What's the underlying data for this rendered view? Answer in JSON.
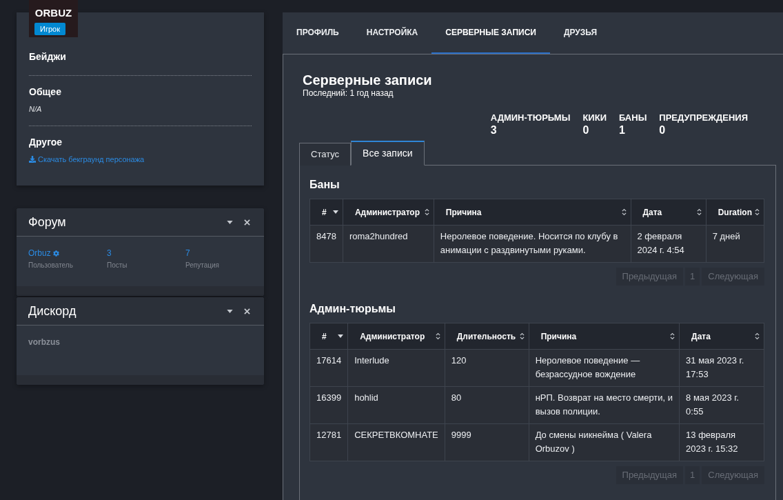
{
  "profile": {
    "name": "ORBUZ",
    "role": "Игрок",
    "sections": [
      {
        "title": "Бейджи"
      },
      {
        "title": "Общее",
        "value": "N/A"
      },
      {
        "title": "Другое",
        "link": "Скачать бекграунд персонажа"
      }
    ]
  },
  "widgets": [
    {
      "title": "Форум",
      "stats": [
        {
          "kind": "user",
          "value": "Orbuz",
          "label": "Пользователь"
        },
        {
          "kind": "count",
          "value": "3",
          "label": "Посты"
        },
        {
          "kind": "count",
          "value": "7",
          "label": "Репутация"
        }
      ]
    },
    {
      "title": "Дискорд",
      "text": "vorbzus"
    }
  ],
  "nav_tabs": [
    {
      "label": "ПРОФИЛЬ",
      "selected": false
    },
    {
      "label": "НАСТРОЙКА",
      "selected": false
    },
    {
      "label": "СЕРВЕРНЫЕ ЗАПИСИ",
      "selected": true
    },
    {
      "label": "ДРУЗЬЯ",
      "selected": false
    }
  ],
  "records": {
    "title": "Серверные записи",
    "subtitle": "Последний: 1 год назад",
    "stats": [
      {
        "label": "АДМИН-ТЮРЬМЫ",
        "value": "3"
      },
      {
        "label": "КИКИ",
        "value": "0"
      },
      {
        "label": "БАНЫ",
        "value": "1"
      },
      {
        "label": "ПРЕДУПРЕЖДЕНИЯ",
        "value": "0"
      }
    ],
    "subtabs": [
      {
        "label": "Статус",
        "selected": false
      },
      {
        "label": "Все записи",
        "selected": true
      }
    ],
    "sections": [
      {
        "title": "Баны",
        "columns": [
          {
            "label": "#",
            "sorted": true
          },
          {
            "label": "Администратор",
            "sorted": false
          },
          {
            "label": "Причина",
            "sorted": false
          },
          {
            "label": "Дата",
            "sorted": false
          },
          {
            "label": "Duration",
            "sorted": false
          }
        ],
        "rows": [
          [
            "8478",
            "roma2hundred",
            "Неролевое поведение. Носится по клубу в анимации с раздвинутыми руками.",
            "2 февраля 2024 г. 4:54",
            "7 дней"
          ]
        ],
        "pagination": [
          {
            "kind": "prev",
            "label": "Предыдущая",
            "disabled": true
          },
          {
            "kind": "page",
            "label": "1",
            "disabled": true
          },
          {
            "kind": "next",
            "label": "Следующая",
            "disabled": true
          }
        ]
      },
      {
        "title": "Админ-тюрьмы",
        "columns": [
          {
            "label": "#",
            "sorted": true
          },
          {
            "label": "Администратор",
            "sorted": false
          },
          {
            "label": "Длительность",
            "sorted": false
          },
          {
            "label": "Причина",
            "sorted": false
          },
          {
            "label": "Дата",
            "sorted": false
          }
        ],
        "rows": [
          [
            "17614",
            "Interlude",
            "120",
            "Неролевое поведение — безрассудное вождение",
            "31 мая 2023 г. 17:53"
          ],
          [
            "16399",
            "hohlid",
            "80",
            "нРП. Возврат на место смерти, и вызов полиции.",
            "8 мая 2023 г. 0:55"
          ],
          [
            "12781",
            "СЕКРЕТВКОМНАТЕ",
            "9999",
            "До смены никнейма ( Valera Orbuzov )",
            "13 февраля 2023 г. 15:32"
          ]
        ],
        "pagination": [
          {
            "kind": "prev",
            "label": "Предыдущая",
            "disabled": true
          },
          {
            "kind": "page",
            "label": "1",
            "disabled": true
          },
          {
            "kind": "next",
            "label": "Следующая",
            "disabled": true
          }
        ]
      }
    ]
  }
}
